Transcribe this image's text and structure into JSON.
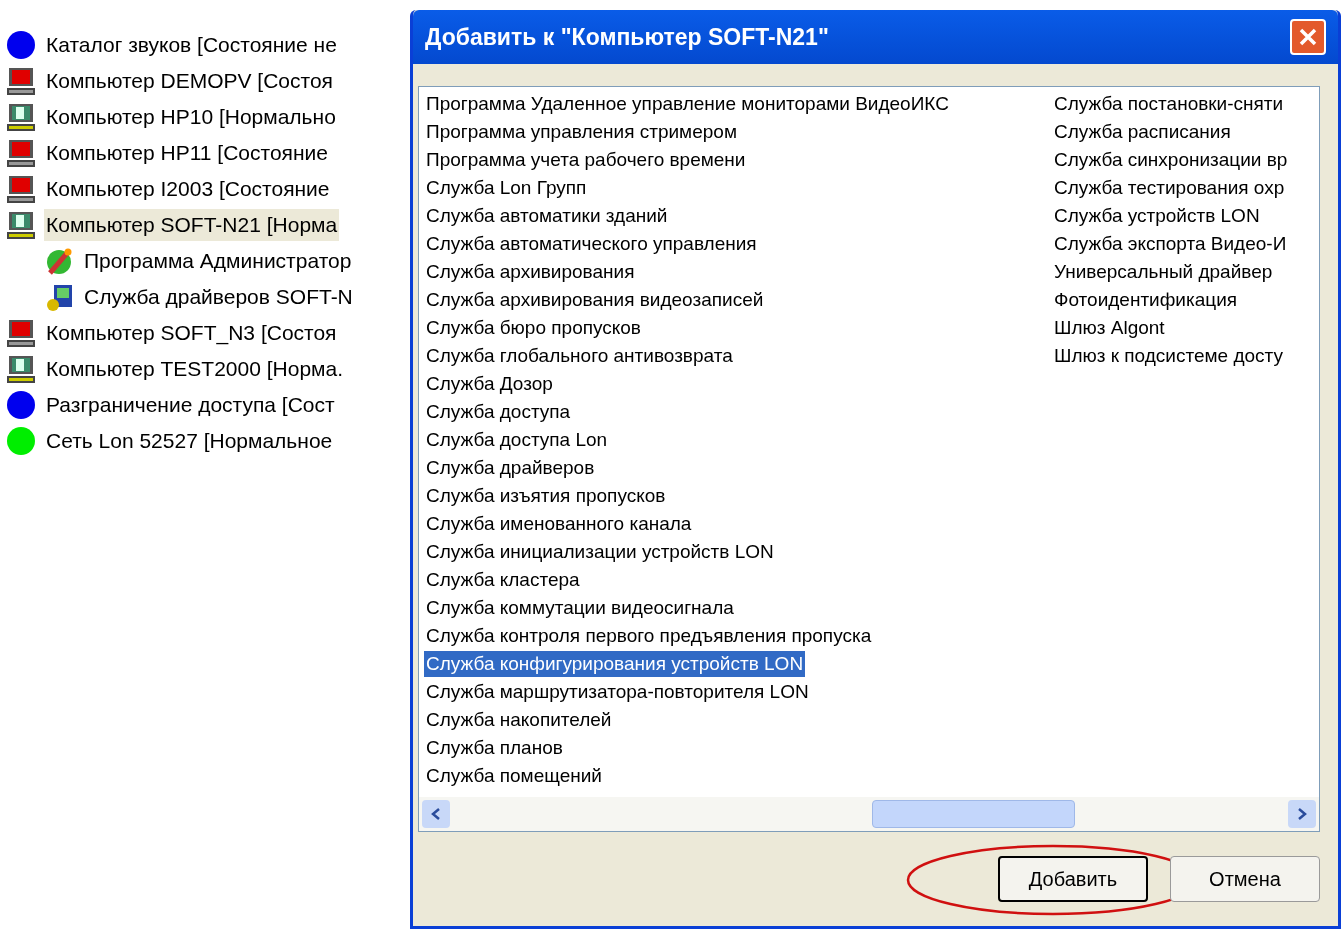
{
  "tree": {
    "items": [
      {
        "kind": "dot",
        "color": "#0000ee",
        "label": "Каталог звуков [Состояние не",
        "selected": false
      },
      {
        "kind": "computer",
        "normal": false,
        "label": "Компьютер DEMOPV [Состоя",
        "selected": false
      },
      {
        "kind": "computer",
        "normal": true,
        "label": "Компьютер HP10 [Нормально",
        "selected": false
      },
      {
        "kind": "computer",
        "normal": false,
        "label": "Компьютер HP11 [Состояние",
        "selected": false
      },
      {
        "kind": "computer",
        "normal": false,
        "label": "Компьютер I2003 [Состояние",
        "selected": false
      },
      {
        "kind": "computer",
        "normal": true,
        "label": "Компьютер SOFT-N21 [Норма",
        "selected": true,
        "children": [
          {
            "kind": "program",
            "label": "Программа Администратор",
            "selected": false
          },
          {
            "kind": "driver",
            "label": "Служба драйверов SOFT-N",
            "selected": false
          }
        ]
      },
      {
        "kind": "computer",
        "normal": false,
        "label": "Компьютер SOFT_N3 [Состоя",
        "selected": false
      },
      {
        "kind": "computer",
        "normal": true,
        "label": "Компьютер TEST2000 [Норма.",
        "selected": false
      },
      {
        "kind": "dot",
        "color": "#0000ee",
        "label": "Разграничение доступа [Сост",
        "selected": false
      },
      {
        "kind": "dot",
        "color": "#00ee00",
        "label": "Сеть Lon 52527 [Нормальное",
        "selected": false
      }
    ]
  },
  "dialog": {
    "title": "Добавить к \"Компьютер SOFT-N21\"",
    "list": {
      "columns": [
        [
          {
            "label": "Программа Удаленное управление мониторами ВидеоИКС",
            "selected": false
          },
          {
            "label": "Программа управления стримером",
            "selected": false
          },
          {
            "label": "Программа учета рабочего времени",
            "selected": false
          },
          {
            "label": "Служба Lon Групп",
            "selected": false
          },
          {
            "label": "Служба автоматики зданий",
            "selected": false
          },
          {
            "label": "Служба автоматического управления",
            "selected": false
          },
          {
            "label": "Служба архивирования",
            "selected": false
          },
          {
            "label": "Служба архивирования видеозаписей",
            "selected": false
          },
          {
            "label": "Служба бюро пропусков",
            "selected": false
          },
          {
            "label": "Служба глобального антивозврата",
            "selected": false
          },
          {
            "label": "Служба Дозор",
            "selected": false
          },
          {
            "label": "Служба доступа",
            "selected": false
          },
          {
            "label": "Служба доступа Lon",
            "selected": false
          },
          {
            "label": "Служба драйверов",
            "selected": false
          },
          {
            "label": "Служба изъятия пропусков",
            "selected": false
          },
          {
            "label": "Служба именованного канала",
            "selected": false
          },
          {
            "label": "Служба инициализации устройств LON",
            "selected": false
          },
          {
            "label": "Служба кластера",
            "selected": false
          },
          {
            "label": "Служба коммутации видеосигнала",
            "selected": false
          },
          {
            "label": "Служба контроля первого предъявления пропуска",
            "selected": false
          },
          {
            "label": "Служба конфигурирования устройств LON",
            "selected": true
          },
          {
            "label": "Служба маршрутизатора-повторителя LON",
            "selected": false
          },
          {
            "label": "Служба накопителей",
            "selected": false
          },
          {
            "label": "Служба планов",
            "selected": false
          },
          {
            "label": "Служба помещений",
            "selected": false
          }
        ],
        [
          {
            "label": "Служба постановки-сняти",
            "selected": false
          },
          {
            "label": "Служба расписания",
            "selected": false
          },
          {
            "label": "Служба синхронизации вр",
            "selected": false
          },
          {
            "label": "Служба тестирования охр",
            "selected": false
          },
          {
            "label": "Служба устройств LON",
            "selected": false
          },
          {
            "label": "Служба экспорта Видео-И",
            "selected": false
          },
          {
            "label": "Универсальный драйвер",
            "selected": false
          },
          {
            "label": "Фотоидентификация",
            "selected": false
          },
          {
            "label": "Шлюз Algont",
            "selected": false
          },
          {
            "label": "Шлюз к подсистеме досту",
            "selected": false
          }
        ]
      ]
    },
    "buttons": [
      {
        "label": "Добавить",
        "default": true
      },
      {
        "label": "Отмена",
        "default": false
      }
    ]
  }
}
